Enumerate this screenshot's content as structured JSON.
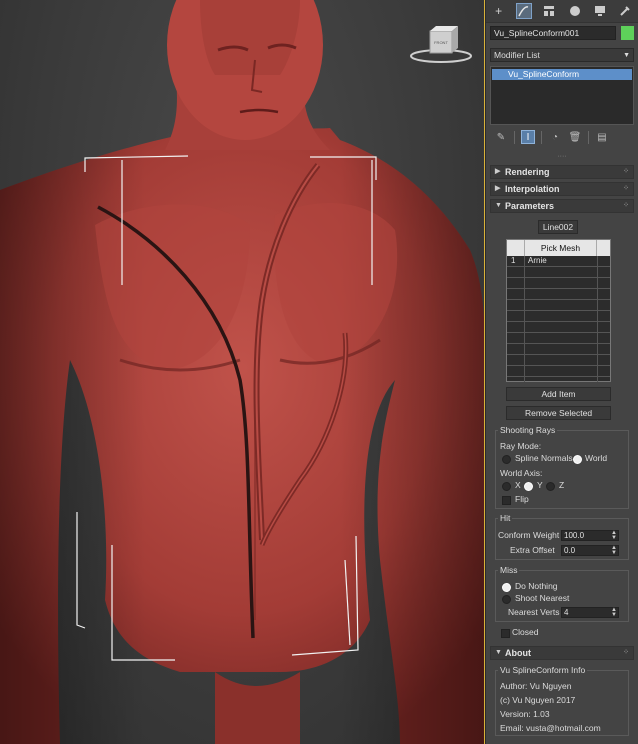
{
  "toolbar": {
    "icons": [
      "create-icon",
      "modify-icon",
      "hierarchy-icon",
      "motion-icon",
      "display-icon",
      "utilities-icon"
    ]
  },
  "object": {
    "name": "Vu_SplineConform001",
    "color": "#5ed15a"
  },
  "modifier_list": {
    "label": "Modifier List"
  },
  "stack": {
    "items": [
      "Vu_SplineConform"
    ]
  },
  "rollouts": {
    "rendering": "Rendering",
    "interpolation": "Interpolation",
    "parameters": "Parameters",
    "about": "About"
  },
  "parameters": {
    "spline_button": "Line002",
    "table": {
      "header": "Pick Mesh",
      "rows": [
        {
          "index": "1",
          "name": "Arnie"
        }
      ]
    },
    "add_item": "Add Item",
    "remove_selected": "Remove Selected",
    "shooting_rays": {
      "title": "Shooting Rays",
      "ray_mode_label": "Ray Mode:",
      "spline_normals": "Spline Normals",
      "world": "World",
      "world_axis_label": "World Axis:",
      "x": "X",
      "y": "Y",
      "z": "Z",
      "flip": "Flip"
    },
    "hit": {
      "title": "Hit",
      "conform_weight_label": "Conform Weight",
      "conform_weight": "100.0",
      "extra_offset_label": "Extra Offset",
      "extra_offset": "0.0"
    },
    "miss": {
      "title": "Miss",
      "do_nothing": "Do Nothing",
      "shoot_nearest": "Shoot Nearest",
      "nearest_verts_label": "Nearest Verts",
      "nearest_verts": "4"
    },
    "closed": "Closed"
  },
  "about": {
    "title": "Vu SplineConform Info",
    "author": "Author: Vu Nguyen",
    "copyright": "(c) Vu Nguyen 2017",
    "version": "Version: 1.03",
    "email": "Email: vusta@hotmail.com"
  },
  "viewcube": {
    "label": "FRONT"
  }
}
